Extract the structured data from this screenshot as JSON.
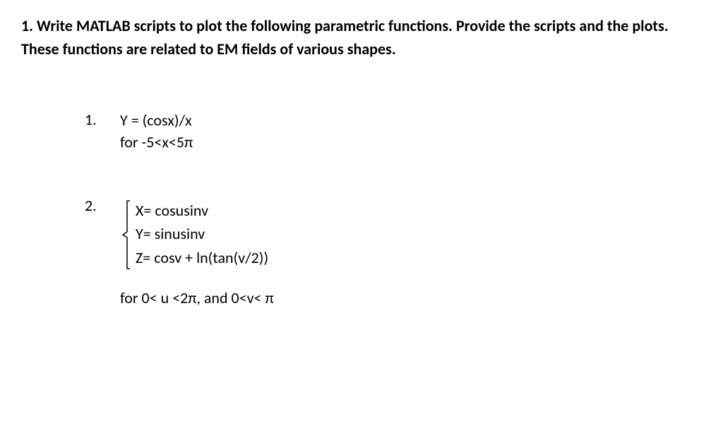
{
  "header": {
    "text": "1. Write MATLAB scripts to plot the following parametric functions. Provide the scripts and the plots. These functions are related to EM fields of various shapes."
  },
  "problems": {
    "item1": {
      "number": "1.",
      "eq1": "Y = (cosx)/x",
      "domain": "for -5<x<5π"
    },
    "item2": {
      "number": "2.",
      "eq1": "X= cosusinv",
      "eq2": "Y= sinusinv",
      "eq3": "Z= cosv + ln(tan(v/2))",
      "domain": "for  0< u <2π, and 0<v< π"
    }
  }
}
